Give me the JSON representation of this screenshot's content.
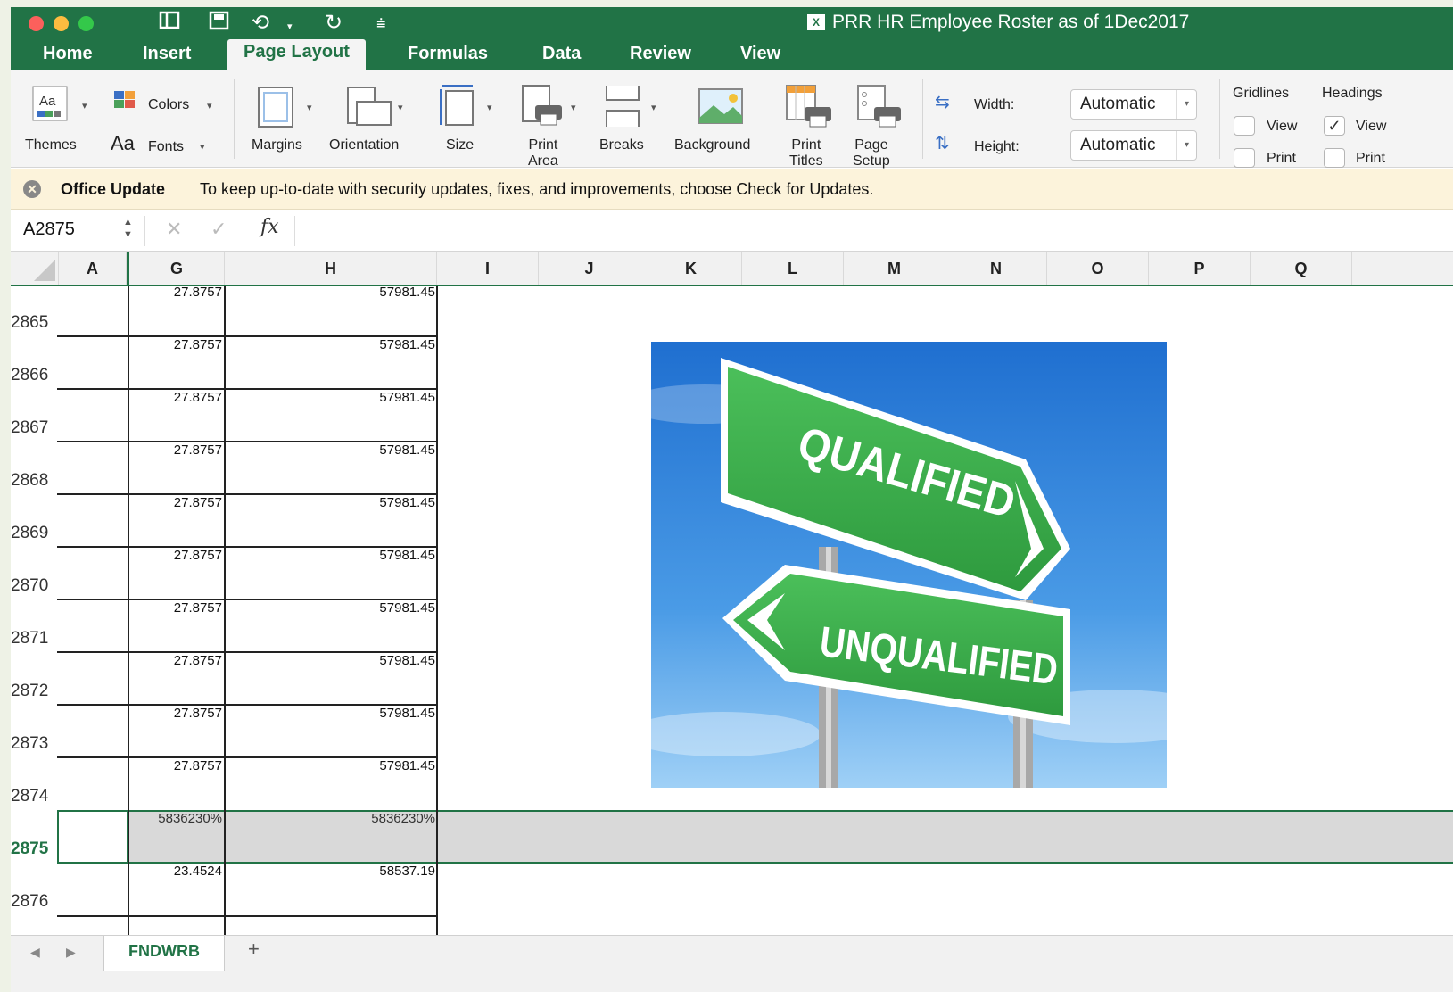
{
  "window": {
    "title": "PRR HR Employee Roster as of 1Dec2017"
  },
  "tabs": [
    "Home",
    "Insert",
    "Page Layout",
    "Formulas",
    "Data",
    "Review",
    "View"
  ],
  "ribbon": {
    "themes": "Themes",
    "colors": "Colors",
    "fonts": "Fonts",
    "fonts_glyph": "Aa",
    "margins": "Margins",
    "orientation": "Orientation",
    "size": "Size",
    "print_area_1": "Print",
    "print_area_2": "Area",
    "breaks": "Breaks",
    "background": "Background",
    "print_titles_1": "Print",
    "print_titles_2": "Titles",
    "page_setup_1": "Page",
    "page_setup_2": "Setup",
    "width_label": "Width:",
    "height_label": "Height:",
    "width_value": "Automatic",
    "height_value": "Automatic",
    "gridlines": "Gridlines",
    "headings": "Headings",
    "view": "View",
    "print": "Print"
  },
  "message": {
    "title": "Office Update",
    "text": "To keep up-to-date with security updates, fixes, and improvements, choose Check for Updates."
  },
  "formula": {
    "namebox": "A2875",
    "fx": "fx",
    "cancel": "✕",
    "enter": "✓"
  },
  "columns": [
    "A",
    "G",
    "H",
    "I",
    "J",
    "K",
    "L",
    "M",
    "N",
    "O",
    "P",
    "Q"
  ],
  "rows": [
    {
      "num": "2865",
      "g": "27.8757",
      "h": "57981.45"
    },
    {
      "num": "2866",
      "g": "27.8757",
      "h": "57981.45"
    },
    {
      "num": "2867",
      "g": "27.8757",
      "h": "57981.45"
    },
    {
      "num": "2868",
      "g": "27.8757",
      "h": "57981.45"
    },
    {
      "num": "2869",
      "g": "27.8757",
      "h": "57981.45"
    },
    {
      "num": "2870",
      "g": "27.8757",
      "h": "57981.45"
    },
    {
      "num": "2871",
      "g": "27.8757",
      "h": "57981.45"
    },
    {
      "num": "2872",
      "g": "27.8757",
      "h": "57981.45"
    },
    {
      "num": "2873",
      "g": "27.8757",
      "h": "57981.45"
    },
    {
      "num": "2874",
      "g": "27.8757",
      "h": "57981.45"
    },
    {
      "num": "2875",
      "g": "5836230%",
      "h": "5836230%"
    },
    {
      "num": "2876",
      "g": "23.4524",
      "h": "58537.19"
    }
  ],
  "top_partial": {
    "g": "27.8757",
    "h": "57981.45"
  },
  "picture": {
    "sign_top": "QUALIFIED",
    "sign_bottom": "UNQUALIFIED"
  },
  "sheet": {
    "tab": "FNDWRB",
    "add": "+"
  }
}
